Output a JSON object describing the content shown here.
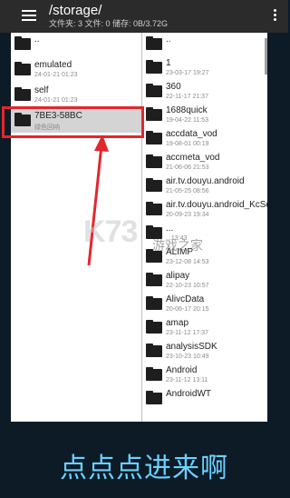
{
  "header": {
    "title": "/storage/",
    "subtitle": "文件夹: 3  文件: 0  储存: 0B/3.72G"
  },
  "left_pane": {
    "items": [
      {
        "name": "..",
        "date": ""
      },
      {
        "name": "emulated",
        "date": "24-01-21 01:23"
      },
      {
        "name": "self",
        "date": "24-01-21 01:23"
      },
      {
        "name": "7BE3-58BC",
        "date": "绿色回响"
      }
    ]
  },
  "right_pane": {
    "items": [
      {
        "name": "..",
        "date": ""
      },
      {
        "name": "1",
        "date": "23-03-17 19:27"
      },
      {
        "name": "360",
        "date": "22-11-17 21:37"
      },
      {
        "name": "1688quick",
        "date": "19-04-22 11:53"
      },
      {
        "name": "accdata_vod",
        "date": "19-08-01 00:19"
      },
      {
        "name": "accmeta_vod",
        "date": "21-06-06 21:53"
      },
      {
        "name": "air.tv.douyu.android",
        "date": "21-05-25 08:56"
      },
      {
        "name": "air.tv.douyu.android_KcSdk",
        "date": "20-09-23 19:34"
      },
      {
        "name": "...",
        "date": "...13:43"
      },
      {
        "name": "ALIMP",
        "date": "23-12-08 14:53"
      },
      {
        "name": "alipay",
        "date": "22-10-23 10:57"
      },
      {
        "name": "AlivcData",
        "date": "20-06-17 20:15"
      },
      {
        "name": "amap",
        "date": "23-11-12 17:37"
      },
      {
        "name": "analysisSDK",
        "date": "23-10-23 10:49"
      },
      {
        "name": "Android",
        "date": "23-11-12 13:11"
      },
      {
        "name": "AndroidWT",
        "date": ""
      }
    ]
  },
  "watermark": {
    "logo": "K73",
    "text": "游戏之家"
  },
  "caption": "点点点进来啊",
  "colors": {
    "highlight": "#e3262d",
    "caption": "#6ad1ff",
    "background": "#0d1b27"
  }
}
